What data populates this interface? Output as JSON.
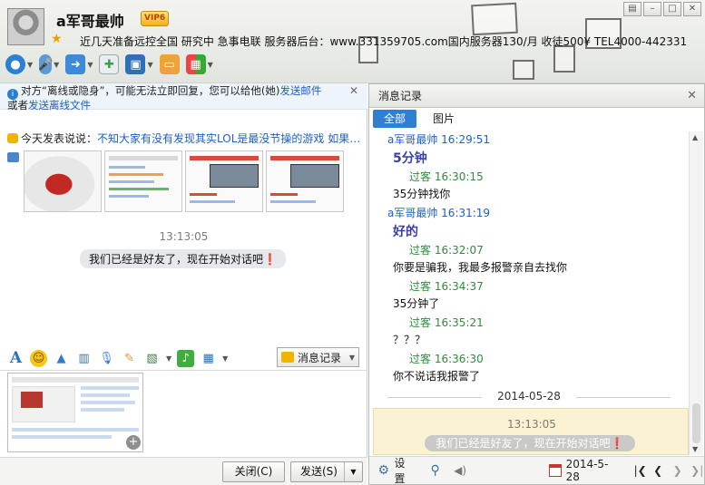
{
  "header": {
    "nickname": "a军哥最帅",
    "vip_label": "VIP6",
    "signature": "近几天准备远控全国  研究中  急事电联  服务器后台：www.331359705.com国内服务器130/月  收徒500¥  TEL4000-442331",
    "toolbar_icons": [
      "video-call-icon",
      "voice-call-icon",
      "transfer-file-icon",
      "chat-group-icon",
      "remote-assist-icon",
      "share-screen-icon",
      "apps-icon"
    ]
  },
  "notice": {
    "text_1": "对方“离线或隐身”，可能无法立即回复，您可以给他(她)",
    "link_mail": "发送邮件",
    "text_2": "或者",
    "link_file": "发送离线文件"
  },
  "mood": {
    "prefix": "今天发表说说：",
    "text": "不知大家有没有发现其实LOL是最没节操的游戏 如果…"
  },
  "chat": {
    "time": "13:13:05",
    "system_message": "我们已经是好友了，现在开始对话吧❗"
  },
  "input_toolbar": {
    "history_label": "消息记录"
  },
  "buttons": {
    "close_label": "关闭(C)",
    "send_label": "发送(S)"
  },
  "history": {
    "title": "消息记录",
    "tab_all": "全部",
    "tab_pics": "图片",
    "messages": [
      {
        "head": "a军哥最帅 16:29:51",
        "kind": "self"
      },
      {
        "body": "5分钟",
        "big": true
      },
      {
        "head": "过客 16:30:15",
        "kind": "peer"
      },
      {
        "body": "35分钟找你"
      },
      {
        "head": "a军哥最帅 16:31:19",
        "kind": "self"
      },
      {
        "body": "好的",
        "big": true
      },
      {
        "head": "过客 16:32:07",
        "kind": "peer"
      },
      {
        "body": "你要是骗我，我最多报警亲自去找你"
      },
      {
        "head": "过客 16:34:37",
        "kind": "peer"
      },
      {
        "body": "35分钟了"
      },
      {
        "head": "过客 16:35:21",
        "kind": "peer"
      },
      {
        "body": "？？？"
      },
      {
        "head": "过客 16:36:30",
        "kind": "peer"
      },
      {
        "body": "你不说话我报警了"
      }
    ],
    "date_separator": "2014-05-28",
    "sys_time": "13:13:05",
    "sys_message": "我们已经是好友了，现在开始对话吧❗",
    "settings_label": "设置",
    "date_value": "2014-5-28"
  },
  "colors": {
    "accent": "#2f7fd3",
    "self_name": "#1f5fbf",
    "peer_name": "#2e8c3b"
  }
}
